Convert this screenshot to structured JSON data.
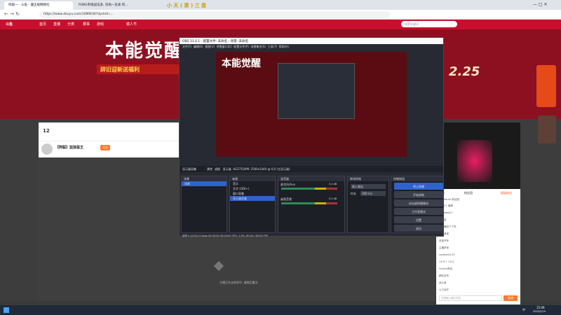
{
  "browser": {
    "tabs": [
      {
        "label": "阿聪一 - 斗鱼 - 遵正规网络社"
      },
      {
        "label": "PUBG单排战法多, 对局一览表 阿..."
      }
    ],
    "url": "https://www.douyu.com/1089636?dyshid=..."
  },
  "site": {
    "logo": "斗鱼",
    "nav": [
      "首页",
      "直播",
      "分类",
      "赛事",
      "游戏",
      "镜人节"
    ],
    "search_placeholder": "搜索关键词",
    "banner_title": "本能觉醒",
    "banner_sub": "辞旧迎新送福利",
    "banner_date": "2.25"
  },
  "streamer": {
    "name": "【阿聪】监狱鼠王",
    "follow": "关注",
    "level": "12"
  },
  "obs": {
    "title": "OBS 31.0.1 - 配置文件: 未命名 - 场景: 未命名",
    "menu": [
      "文件(F)",
      "编辑(E)",
      "视图(V)",
      "停靠窗口(D)",
      "配置文件(P)",
      "场景集合(S)",
      "工具(T)",
      "帮助(H)"
    ],
    "source_bar_label": "显示器采集",
    "properties": "属性",
    "filters": "滤镜",
    "display_label": "显示器",
    "display_value": "AG275QXM: 2560x1440 @ 0,0 (主显示器)",
    "docks": {
      "scenes": {
        "title": "场景",
        "items": [
          "场景"
        ]
      },
      "sources": {
        "title": "来源",
        "items": [
          "音乐",
          "文字 (GDI+)",
          "窗口采集",
          "显示器采集"
        ]
      },
      "mixer": {
        "title": "混音器",
        "tracks": [
          {
            "name": "麦克风/Aux",
            "db": "0.0 dB"
          },
          {
            "name": "桌面音频",
            "db": "0.0 dB"
          }
        ]
      },
      "transitions": {
        "title": "转场特效",
        "type": "渐入渐出",
        "duration_label": "时长",
        "duration": "300 ms"
      },
      "controls": {
        "title": "控制按钮",
        "buttons": [
          "停止直播",
          "开始录制",
          "启动虚拟摄像机",
          "工作室模式",
          "设置",
          "退出"
        ]
      }
    },
    "status": "帧率 0 (0.0%)   0 kbps   00:00:00   00:00:00   CPU: 1.0%, 60.00 / 60.00 FPS"
  },
  "chat": {
    "tabs": [
      "贵宾",
      "粉丝团",
      "超级粉丝"
    ],
    "messages": [
      "Beneficial 粉丝团",
      "1312+ 懂哥",
      "hirnalfea27",
      "哈哈哈",
      "只能爆这个了吗",
      "谁说我菜",
      "老鼠开车",
      "主播好帅",
      "caststein113",
      "1171+ 1111",
      "Hunter再战",
      "精彩击杀",
      "战斗爽",
      "火力全开"
    ],
    "input_placeholder": "这里输入聊天内容",
    "send": "发送"
  },
  "video": {
    "loading": "主播正在去休息中, 请稍后重试"
  },
  "taskbar": {
    "time": "15:09",
    "date": "2025/2/19",
    "lang": "中"
  }
}
